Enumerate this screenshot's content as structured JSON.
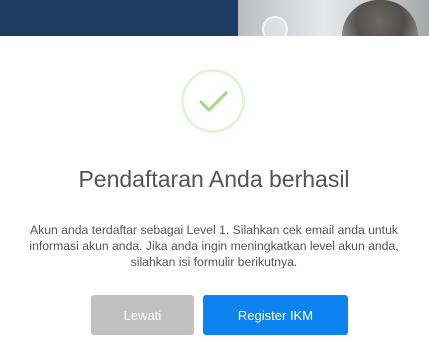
{
  "background": {
    "navy_color": "#1d3c63"
  },
  "modal": {
    "icon": "check-circle-icon",
    "icon_color": "#a5dc86",
    "icon_ring_color": "#e5f3d8",
    "title": "Pendaftaran Anda berhasil",
    "message": "Akun anda terdaftar sebagai Level 1. Silahkan cek email anda untuk informasi akun anda. Jika anda ingin meningkatkan level akun anda, silahkan isi formulir berikutnya.",
    "buttons": {
      "skip_label": "Lewati",
      "skip_color": "#c1c1c1",
      "register_label": "Register IKM",
      "register_color": "#0d83f0"
    }
  }
}
